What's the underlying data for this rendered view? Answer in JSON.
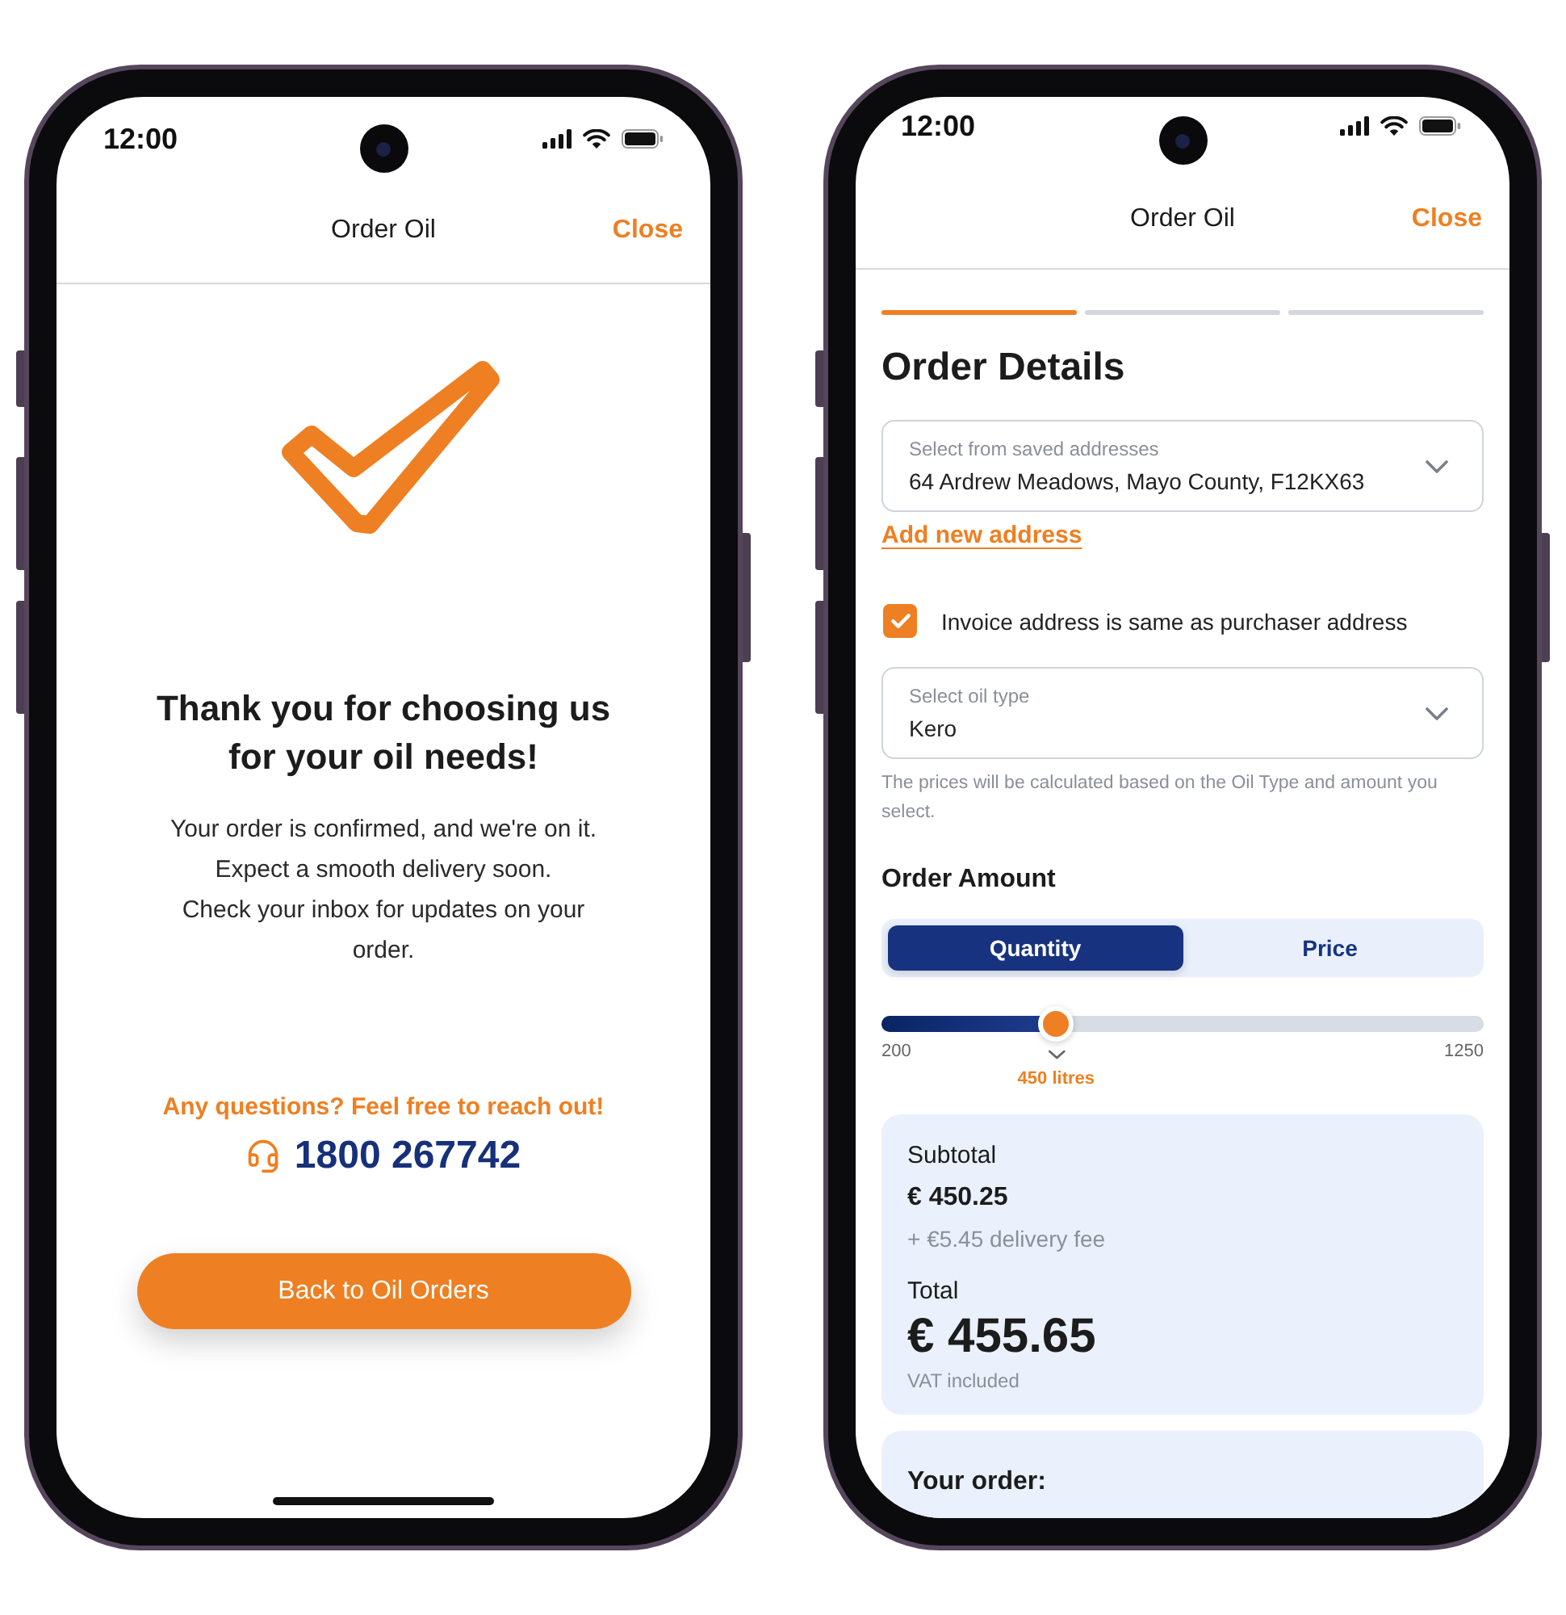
{
  "confirmation_phone": {
    "status_bar": {
      "time": "12:00"
    },
    "nav": {
      "title": "Order Oil",
      "close": "Close"
    },
    "heading": "Thank you for choosing us for your oil needs!",
    "message": [
      "Your order is confirmed, and we're on it.",
      "Expect a smooth delivery soon.",
      "Check your inbox for updates on your order."
    ],
    "support_prompt": "Any questions? Feel free to reach out!",
    "phone_number": "1800 267742",
    "button": "Back to Oil Orders"
  },
  "order_phone": {
    "status_bar": {
      "time": "12:00"
    },
    "nav": {
      "title": "Order Oil",
      "close": "Close"
    },
    "steps": [
      {
        "active": true
      },
      {
        "active": false
      },
      {
        "active": false
      }
    ],
    "heading": "Order Details",
    "address_select": {
      "label": "Select from saved addresses",
      "value": "64 Ardrew Meadows, Mayo County, F12KX63"
    },
    "add_address_link": "Add new address",
    "invoice_checkbox": {
      "label": "Invoice address is same as purchaser address",
      "checked": true
    },
    "oil_type_select": {
      "label": "Select oil type",
      "value": "Kero"
    },
    "oil_type_hint": "The prices will be calculated based on the Oil Type and amount you select.",
    "amount_heading": "Order Amount",
    "amount_tabs": [
      {
        "label": "Quantity",
        "selected": true
      },
      {
        "label": "Price",
        "selected": false
      }
    ],
    "slider": {
      "level": 0.29,
      "min_label": "200",
      "max_label": "1250",
      "value_label": "450 litres"
    },
    "summary": {
      "subtotal_label": "Subtotal",
      "subtotal": "€ 450.25",
      "delivery_fee": "+ €5.45 delivery fee",
      "total_label": "Total",
      "total": "€ 455.65",
      "vat_note": "VAT included"
    },
    "order_card": {
      "title": "Your order:"
    }
  }
}
